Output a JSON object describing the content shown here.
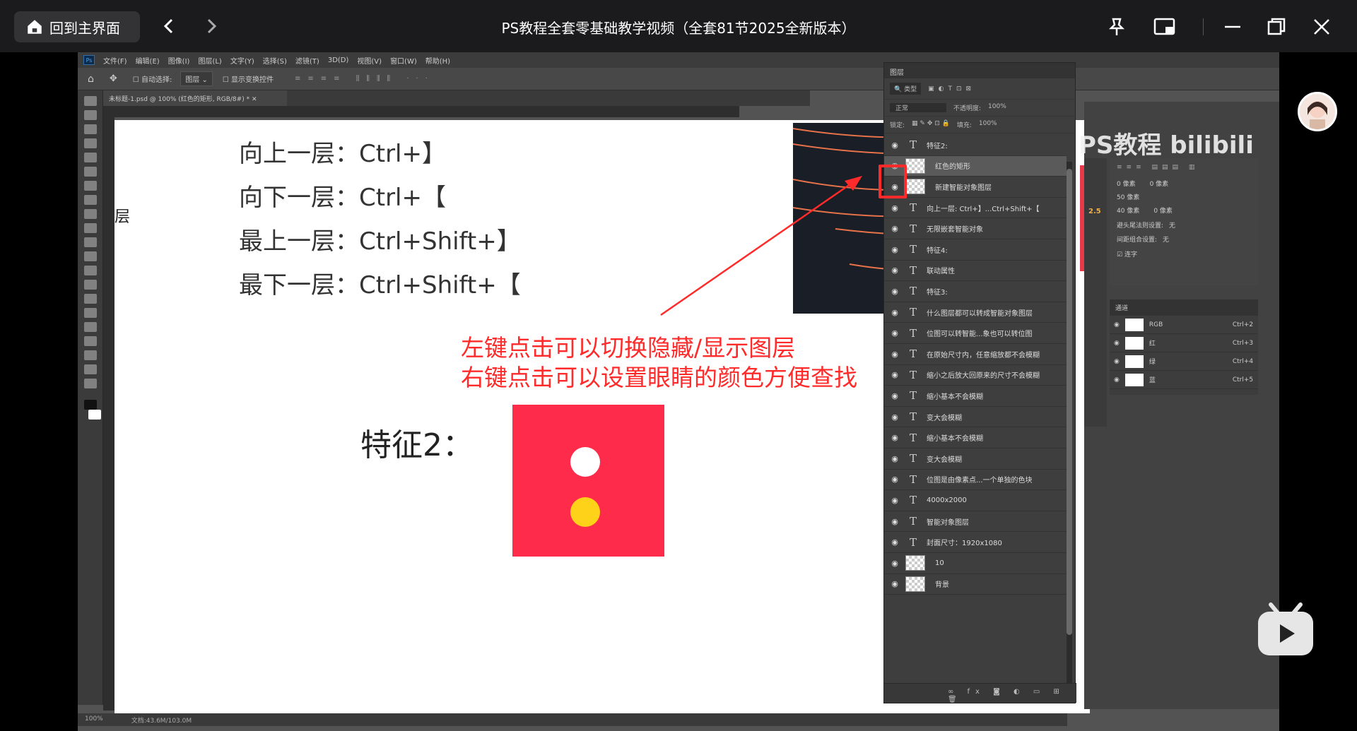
{
  "player": {
    "home_label": "回到主界面",
    "title": "PS教程全套零基础教学视频（全套81节2025全新版本）"
  },
  "ps": {
    "menu": [
      "文件(F)",
      "编辑(E)",
      "图像(I)",
      "图层(L)",
      "文字(Y)",
      "选择(S)",
      "滤镜(T)",
      "3D(D)",
      "视图(V)",
      "窗口(W)",
      "帮助(H)"
    ],
    "options": {
      "auto_select": "自动选择:",
      "auto_select_value": "图层",
      "show_transform": "显示变换控件"
    },
    "doc_tab": "未标题-1.psd @ 100% (红色的矩形, RGB/8#) *",
    "status_zoom": "100%",
    "status_doc": "文档:43.6M/103.0M"
  },
  "canvas": {
    "shortcuts": [
      "向上一层：Ctrl+】",
      "向下一层：Ctrl+【",
      "最上一层：Ctrl+Shift+】",
      "最下一层：Ctrl+Shift+【"
    ],
    "side_char": "层",
    "notes": [
      "左键点击可以切换隐藏/显示图层",
      "右键点击可以设置眼睛的颜色方便查找"
    ],
    "feature_label": "特征2："
  },
  "layers_panel": {
    "title": "图层",
    "filter_kind": "类型",
    "blend_mode": "正常",
    "opacity_label": "不透明度:",
    "opacity_value": "100%",
    "lock_label": "锁定:",
    "fill_label": "填充:",
    "fill_value": "100%",
    "layers": [
      {
        "type": "text",
        "name": "特征2:"
      },
      {
        "type": "image",
        "name": "红色的矩形",
        "selected": true
      },
      {
        "type": "image",
        "name": "新建智能对象图层"
      },
      {
        "type": "text",
        "name": "向上一层: Ctrl+】...Ctrl+Shift+【"
      },
      {
        "type": "text",
        "name": "无限嵌套智能对象"
      },
      {
        "type": "text",
        "name": "特征4:"
      },
      {
        "type": "text",
        "name": "联动属性"
      },
      {
        "type": "text",
        "name": "特征3:"
      },
      {
        "type": "text",
        "name": "什么图层都可以转成智能对象图层"
      },
      {
        "type": "text",
        "name": "位图可以转智能...象也可以转位图"
      },
      {
        "type": "text",
        "name": "在原始尺寸内，任意缩放都不会模糊"
      },
      {
        "type": "text",
        "name": "缩小之后放大回原来的尺寸不会模糊"
      },
      {
        "type": "text",
        "name": "缩小基本不会模糊"
      },
      {
        "type": "text",
        "name": "变大会模糊"
      },
      {
        "type": "text",
        "name": "缩小基本不会模糊"
      },
      {
        "type": "text",
        "name": "变大会模糊"
      },
      {
        "type": "text",
        "name": "位图是由像素点...一个单独的色块"
      },
      {
        "type": "text",
        "name": "4000x2000"
      },
      {
        "type": "text",
        "name": "智能对象图层"
      },
      {
        "type": "text",
        "name": "封面尺寸：1920x1080"
      },
      {
        "type": "image",
        "name": "10"
      },
      {
        "type": "image",
        "name": "背景"
      }
    ]
  },
  "right_panel": {
    "paragraph": [
      "0 像素",
      "0 像素",
      "50 像素",
      "40 像素",
      "0 像素"
    ],
    "avoid_label": "避头尾法则设置:",
    "avoid_value": "无",
    "spacing_label": "间距组合设置:",
    "spacing_value": "无",
    "hyphen": "连字",
    "channels_title": "通道",
    "channels": [
      {
        "name": "RGB",
        "key": "Ctrl+2"
      },
      {
        "name": "红",
        "key": "Ctrl+3"
      },
      {
        "name": "绿",
        "key": "Ctrl+4"
      },
      {
        "name": "蓝",
        "key": "Ctrl+5"
      }
    ],
    "num_badge": "2.5"
  },
  "watermark": "PS教程 bilibili"
}
